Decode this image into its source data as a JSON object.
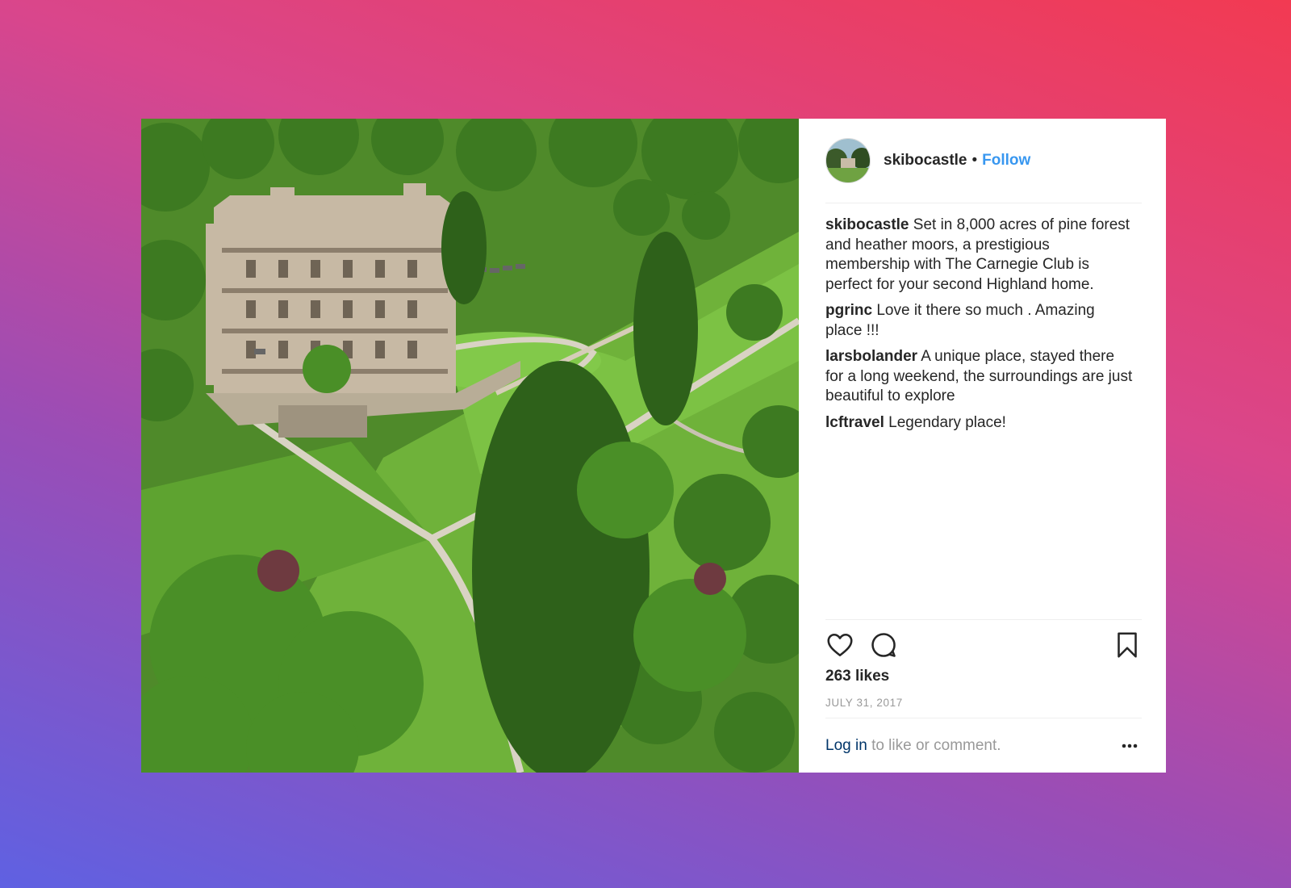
{
  "post": {
    "username": "skibocastle",
    "separator": "•",
    "follow_label": "Follow",
    "comments": [
      {
        "user": "skibocastle",
        "text": "Set in 8,000 acres of pine forest and heather moors, a prestigious membership with The Carnegie Club is perfect for your second Highland home."
      },
      {
        "user": "pgrinc",
        "text": "Love it there so much . Amazing place !!!"
      },
      {
        "user": "larsbolander",
        "text": "A unique place, stayed there for a long weekend, the surroundings are just beautiful to explore"
      },
      {
        "user": "lcftravel",
        "text": "Legendary place!"
      }
    ],
    "likes": "263 likes",
    "date": "JULY 31, 2017",
    "login_link": "Log in",
    "login_rest": "to like or comment."
  },
  "icons": {
    "like": "heart-icon",
    "comment": "comment-icon",
    "save": "bookmark-icon",
    "more": "more-options-icon"
  },
  "colors": {
    "link": "#3897f0",
    "text": "#262626",
    "muted": "#999999",
    "login_link": "#003569"
  }
}
